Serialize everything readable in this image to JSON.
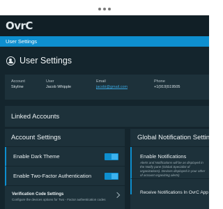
{
  "app": {
    "logo": "OvrC"
  },
  "breadcrumb": {
    "label": "User Settings"
  },
  "page": {
    "title": "User Settings"
  },
  "user_info": {
    "account": {
      "label": "Account",
      "value": "Skyline"
    },
    "user": {
      "label": "User",
      "value": "Jacob Whipple"
    },
    "email": {
      "label": "Email",
      "value": "jacobi@gmail.com"
    },
    "phone": {
      "label": "Phone",
      "value": "+1(919)519505"
    }
  },
  "linked_accounts": {
    "title": "Linked Accounts"
  },
  "account_settings": {
    "title": "Account Settings",
    "dark_theme": {
      "label": "Enable Dark Theme",
      "enabled": true
    },
    "two_factor": {
      "label": "Enable Two-Factor Authentication",
      "enabled": true
    },
    "verification": {
      "title": "Verification Code Settings",
      "description": "Configure the devices options for Two - Factor authentication codes"
    }
  },
  "global_notifications": {
    "title": "Global Notification Settings",
    "enable": {
      "title": "Enable Notifications",
      "line1": "Alerts and Notifications will be as displayed in",
      "line2": "the Notify pane (Global Specialist of",
      "line3": "organizations). Devices displayed in your other",
      "line4": "of account organizing alerts)"
    },
    "receive": {
      "label": "Receive Notifications In OvrC App"
    }
  },
  "colors": {
    "accent": "#0e8fcf",
    "background": "#14252d",
    "panel": "#1d313a"
  }
}
